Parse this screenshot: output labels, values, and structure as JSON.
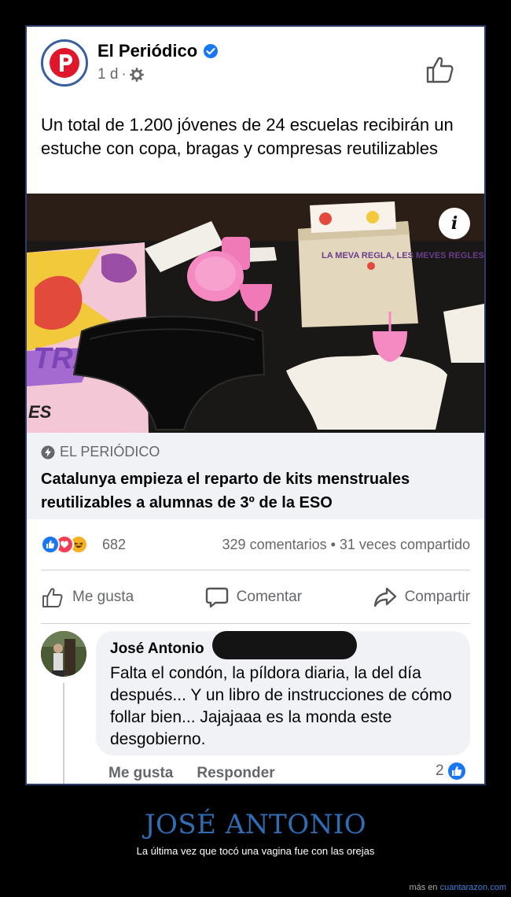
{
  "post": {
    "page_name": "El Periódico",
    "time": "1 d",
    "text": "Un total de 1.200 jóvenes de 24 escuelas recibirán un estuche con copa, bragas y compresas reutilizables",
    "image": {
      "pouch_text": "LA MEVA REGLA, LES MEVES REGLES",
      "card_text": "TRA",
      "partial_text": "ES"
    },
    "link": {
      "source": "EL PERIÓDICO",
      "title": "Catalunya empieza el reparto de kits menstruales reutilizables a alumnas de 3º de la ESO"
    },
    "stats": {
      "reaction_count": "682",
      "engagement": "329 comentarios • 31 veces compartido"
    },
    "actions": {
      "like": "Me gusta",
      "comment": "Comentar",
      "share": "Compartir"
    }
  },
  "comment": {
    "author": "José Antonio",
    "text": "Falta el condón, la píldora diaria, la del día después... Y un libro de instrucciones de cómo follar bien... Jajajaaa es la monda este desgobierno.",
    "like_label": "Me gusta",
    "reply_label": "Responder",
    "like_count": "2"
  },
  "meme": {
    "title": "JOSÉ ANTONIO",
    "caption": "La última vez que tocó una vagina fue con las orejas"
  },
  "watermark": {
    "prefix": "más en ",
    "site": "cuantarazon.com"
  },
  "colors": {
    "facebook_blue": "#1877f2",
    "title_blue": "#2f6db5",
    "brand_red": "#e0162b"
  }
}
